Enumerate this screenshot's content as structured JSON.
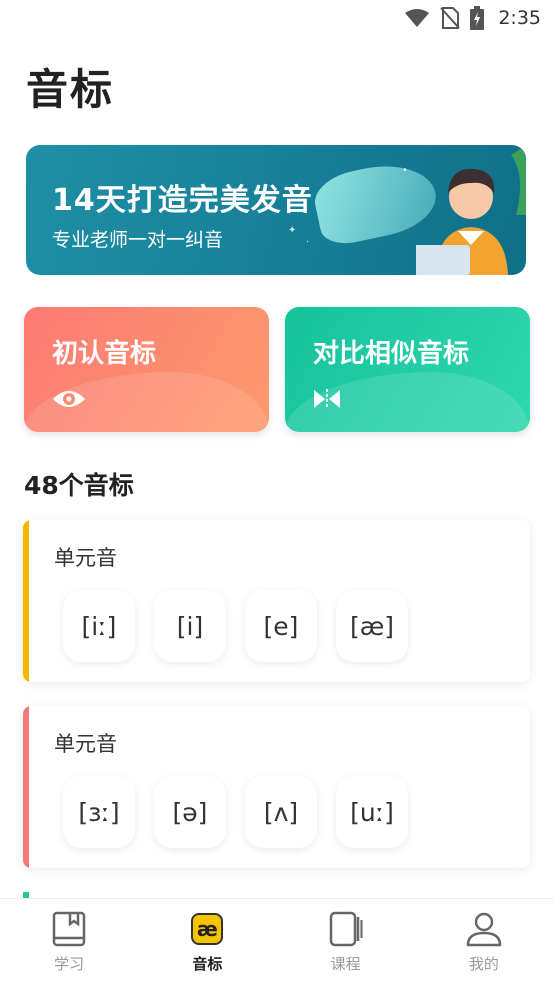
{
  "status_bar": {
    "time": "2:35"
  },
  "page": {
    "title": "音标"
  },
  "banner": {
    "title": "14天打造完美发音",
    "subtitle": "专业老师一对一纠音"
  },
  "features": [
    {
      "label": "初认音标",
      "icon": "eye-icon"
    },
    {
      "label": "对比相似音标",
      "icon": "compare-icon"
    }
  ],
  "section": {
    "title": "48个音标"
  },
  "groups": [
    {
      "title": "单元音",
      "accent": "#f5b800",
      "symbols": [
        "[iː]",
        "[i]",
        "[e]",
        "[æ]"
      ]
    },
    {
      "title": "单元音",
      "accent": "#f47a7a",
      "symbols": [
        "[ɜː]",
        "[ə]",
        "[ʌ]",
        "[uː]"
      ]
    }
  ],
  "nav": [
    {
      "label": "学习",
      "icon": "book-icon"
    },
    {
      "label": "音标",
      "icon": "ae-icon",
      "glyph": "æ",
      "active": true
    },
    {
      "label": "课程",
      "icon": "course-icon"
    },
    {
      "label": "我的",
      "icon": "profile-icon"
    }
  ]
}
